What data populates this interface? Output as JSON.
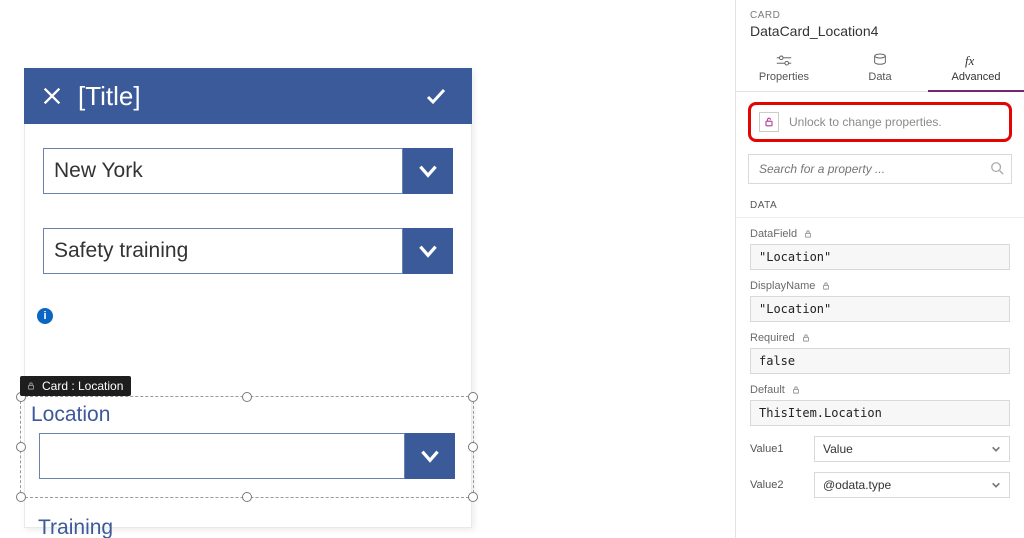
{
  "form": {
    "title": "[Title]",
    "dropdown1": {
      "value": "New York"
    },
    "dropdown2": {
      "value": "Safety training"
    },
    "selected_card": {
      "tooltip": "Card : Location",
      "label": "Location",
      "value": ""
    },
    "next_card_label": "Training",
    "info_badge": "i"
  },
  "panel": {
    "type_label": "CARD",
    "control_name": "DataCard_Location4",
    "tabs": {
      "properties": "Properties",
      "data": "Data",
      "advanced": "Advanced"
    },
    "unlock_msg": "Unlock to change properties.",
    "search_placeholder": "Search for a property ...",
    "data_section": {
      "title": "DATA",
      "props": {
        "DataField": {
          "label": "DataField",
          "value": "\"Location\""
        },
        "DisplayName": {
          "label": "DisplayName",
          "value": "\"Location\""
        },
        "Required": {
          "label": "Required",
          "value": "false"
        },
        "Default": {
          "label": "Default",
          "value": "ThisItem.Location"
        }
      },
      "value_rows": {
        "Value1": {
          "label": "Value1",
          "selected": "Value"
        },
        "Value2": {
          "label": "Value2",
          "selected": "@odata.type"
        }
      }
    }
  }
}
